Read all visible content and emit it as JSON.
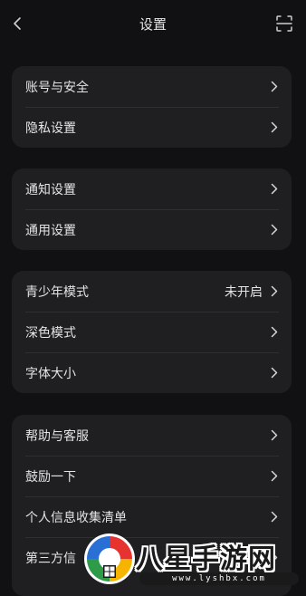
{
  "header": {
    "title": "设置",
    "back_icon": "chevron-left-icon",
    "scan_icon": "scan-icon"
  },
  "groups": [
    {
      "items": [
        {
          "label": "账号与安全"
        },
        {
          "label": "隐私设置"
        }
      ]
    },
    {
      "items": [
        {
          "label": "通知设置"
        },
        {
          "label": "通用设置"
        }
      ]
    },
    {
      "items": [
        {
          "label": "青少年模式",
          "value": "未开启"
        },
        {
          "label": "深色模式"
        },
        {
          "label": "字体大小"
        }
      ]
    },
    {
      "items": [
        {
          "label": "帮助与客服"
        },
        {
          "label": "鼓励一下"
        },
        {
          "label": "个人信息收集清单"
        },
        {
          "label": "第三方信"
        }
      ]
    }
  ],
  "watermark": {
    "text": "八星手游网",
    "url": "www.lyshbx.com"
  },
  "colors": {
    "background": "#111113",
    "card": "#1f1f22",
    "text": "#e4e4e6"
  }
}
